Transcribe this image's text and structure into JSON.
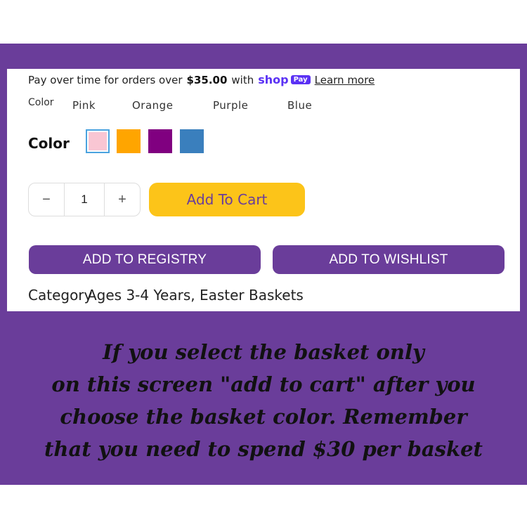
{
  "payment": {
    "prefix": "Pay over time for orders over",
    "amount": "$35.00",
    "with": "with",
    "brand": "shop",
    "badge": "Pay",
    "link": "Learn more"
  },
  "color_small_label": "Color",
  "color_names": [
    "Pink",
    "Orange",
    "Purple",
    "Blue"
  ],
  "color_heading": "Color",
  "swatches": [
    {
      "name": "Pink",
      "color": "#f9c6d3",
      "selected": true
    },
    {
      "name": "Orange",
      "color": "#ffa500",
      "selected": false
    },
    {
      "name": "Purple",
      "color": "#800080",
      "selected": false
    },
    {
      "name": "Blue",
      "color": "#3a7fbd",
      "selected": false
    }
  ],
  "quantity": {
    "minus": "−",
    "value": "1",
    "plus": "+"
  },
  "add_to_cart": "Add To Cart",
  "registry_button": "ADD TO REGISTRY",
  "wishlist_button": "ADD TO WISHLIST",
  "category": {
    "label": "Category",
    "values": "Ages 3-4 Years,  Easter Baskets"
  },
  "caption": [
    "If you select the basket only",
    "on this screen \"add to cart\" after you",
    "choose the basket color.  Remember",
    "that you need to spend $30 per basket"
  ],
  "colors": {
    "purple": "#6a3d9a",
    "yellow": "#fcc419",
    "shop_pay": "#5a31f4"
  }
}
